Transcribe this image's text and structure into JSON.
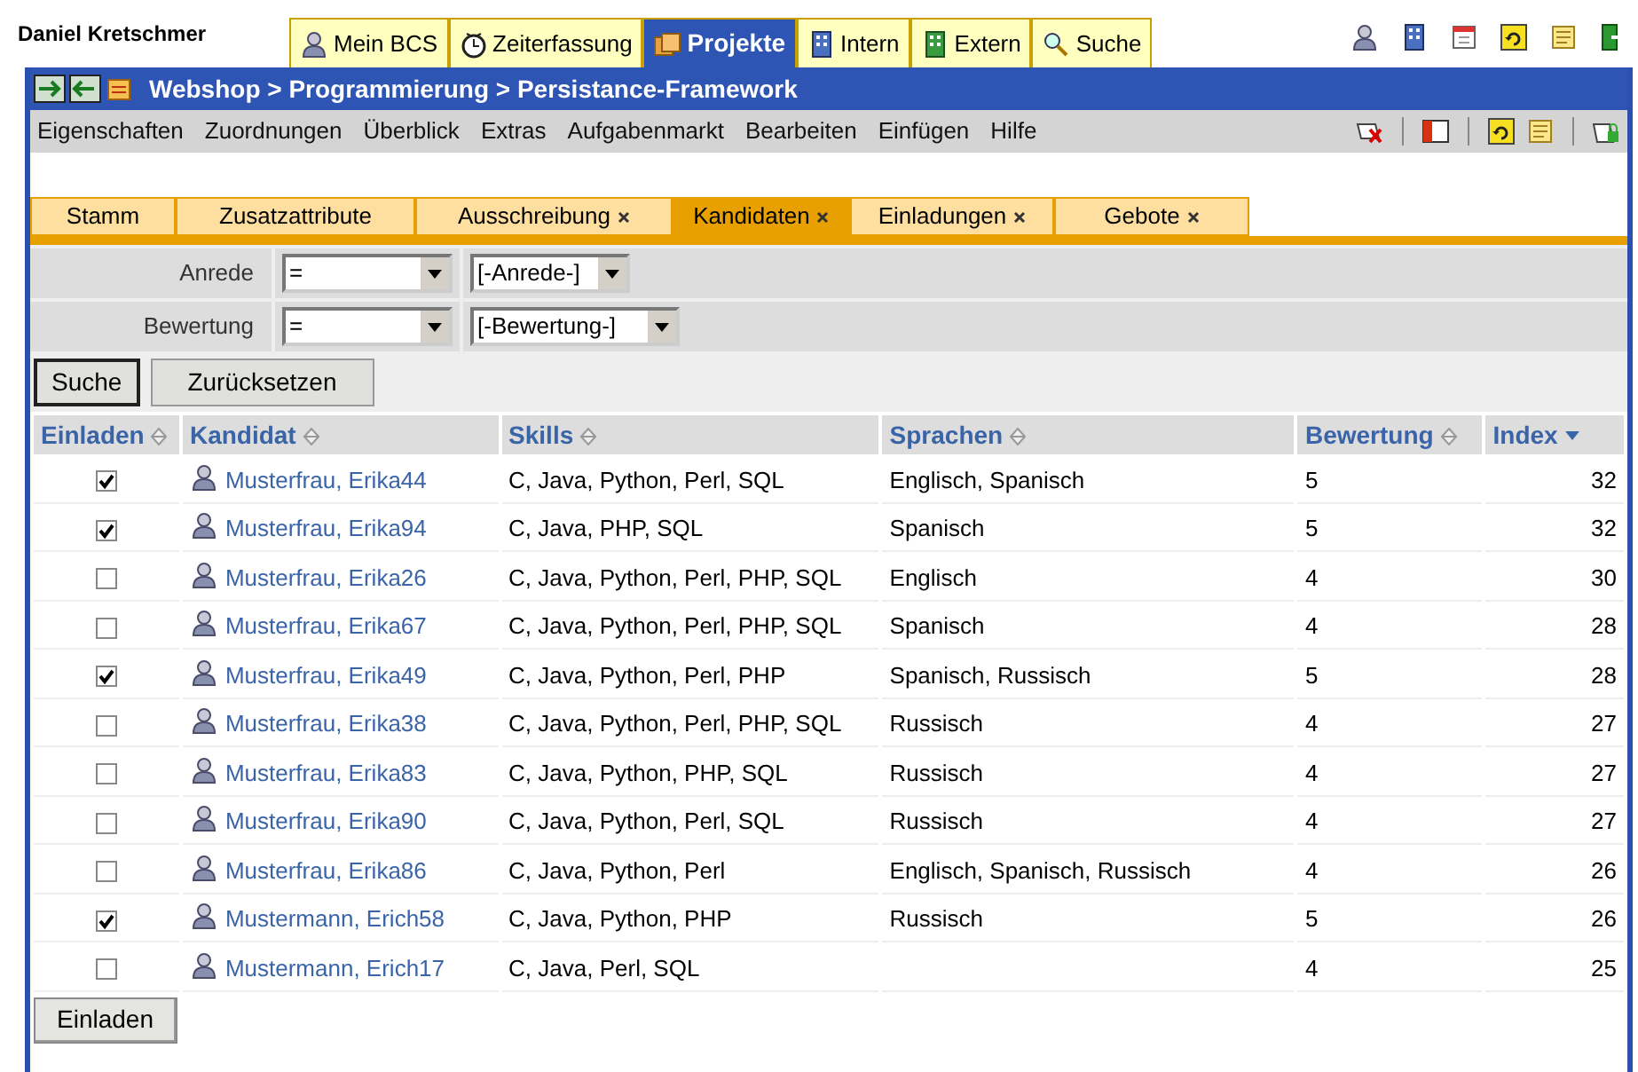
{
  "user": "Daniel Kretschmer",
  "main_tabs": [
    {
      "label": "Mein BCS",
      "selected": false
    },
    {
      "label": "Zeiterfassung",
      "selected": false
    },
    {
      "label": "Projekte",
      "selected": true
    },
    {
      "label": "Intern",
      "selected": false
    },
    {
      "label": "Extern",
      "selected": false
    },
    {
      "label": "Suche",
      "selected": false
    }
  ],
  "breadcrumb": "Webshop > Programmierung > Persistance-Framework",
  "menu": [
    "Eigenschaften",
    "Zuordnungen",
    "Überblick",
    "Extras",
    "Aufgabenmarkt",
    "Bearbeiten",
    "Einfügen",
    "Hilfe"
  ],
  "sub_tabs": [
    {
      "label": "Stamm",
      "selected": false,
      "closable": false
    },
    {
      "label": "Zusatzattribute",
      "selected": false,
      "closable": false
    },
    {
      "label": "Ausschreibung",
      "selected": false,
      "closable": true
    },
    {
      "label": "Kandidaten",
      "selected": true,
      "closable": true
    },
    {
      "label": "Einladungen",
      "selected": false,
      "closable": true
    },
    {
      "label": "Gebote",
      "selected": false,
      "closable": true
    }
  ],
  "filters": [
    {
      "label": "Anrede",
      "operator": "=",
      "value": "[-Anrede-]"
    },
    {
      "label": "Bewertung",
      "operator": "=",
      "value": "[-Bewertung-]"
    }
  ],
  "filter_buttons": [
    "Suche",
    "Zurücksetzen"
  ],
  "table": {
    "columns": [
      {
        "label": "Einladen",
        "sorted": false
      },
      {
        "label": "Kandidat",
        "sorted": false
      },
      {
        "label": "Skills",
        "sorted": false
      },
      {
        "label": "Sprachen",
        "sorted": false
      },
      {
        "label": "Bewertung",
        "sorted": false
      },
      {
        "label": "Index",
        "sorted": true
      }
    ],
    "rows": [
      {
        "checked": true,
        "name": "Musterfrau, Erika44",
        "skills": "C, Java, Python, Perl, SQL",
        "languages": "Englisch, Spanisch",
        "rating": "5",
        "index": "32"
      },
      {
        "checked": true,
        "name": "Musterfrau, Erika94",
        "skills": "C, Java, PHP, SQL",
        "languages": "Spanisch",
        "rating": "5",
        "index": "32"
      },
      {
        "checked": false,
        "name": "Musterfrau, Erika26",
        "skills": "C, Java, Python, Perl, PHP, SQL",
        "languages": "Englisch",
        "rating": "4",
        "index": "30"
      },
      {
        "checked": false,
        "name": "Musterfrau, Erika67",
        "skills": "C, Java, Python, Perl, PHP, SQL",
        "languages": "Spanisch",
        "rating": "4",
        "index": "28"
      },
      {
        "checked": true,
        "name": "Musterfrau, Erika49",
        "skills": "C, Java, Python, Perl, PHP",
        "languages": "Spanisch, Russisch",
        "rating": "5",
        "index": "28"
      },
      {
        "checked": false,
        "name": "Musterfrau, Erika38",
        "skills": "C, Java, Python, Perl, PHP, SQL",
        "languages": "Russisch",
        "rating": "4",
        "index": "27"
      },
      {
        "checked": false,
        "name": "Musterfrau, Erika83",
        "skills": "C, Java, Python, PHP, SQL",
        "languages": "Russisch",
        "rating": "4",
        "index": "27"
      },
      {
        "checked": false,
        "name": "Musterfrau, Erika90",
        "skills": "C, Java, Python, Perl, SQL",
        "languages": "Russisch",
        "rating": "4",
        "index": "27"
      },
      {
        "checked": false,
        "name": "Musterfrau, Erika86",
        "skills": "C, Java, Python, Perl",
        "languages": "Englisch, Spanisch, Russisch",
        "rating": "4",
        "index": "26"
      },
      {
        "checked": true,
        "name": "Mustermann, Erich58",
        "skills": "C, Java, Python, PHP",
        "languages": "Russisch",
        "rating": "5",
        "index": "26"
      },
      {
        "checked": false,
        "name": "Mustermann, Erich17",
        "skills": "C, Java, Perl, SQL",
        "rating": "4",
        "index": "25"
      }
    ]
  },
  "action_button": "Einladen"
}
